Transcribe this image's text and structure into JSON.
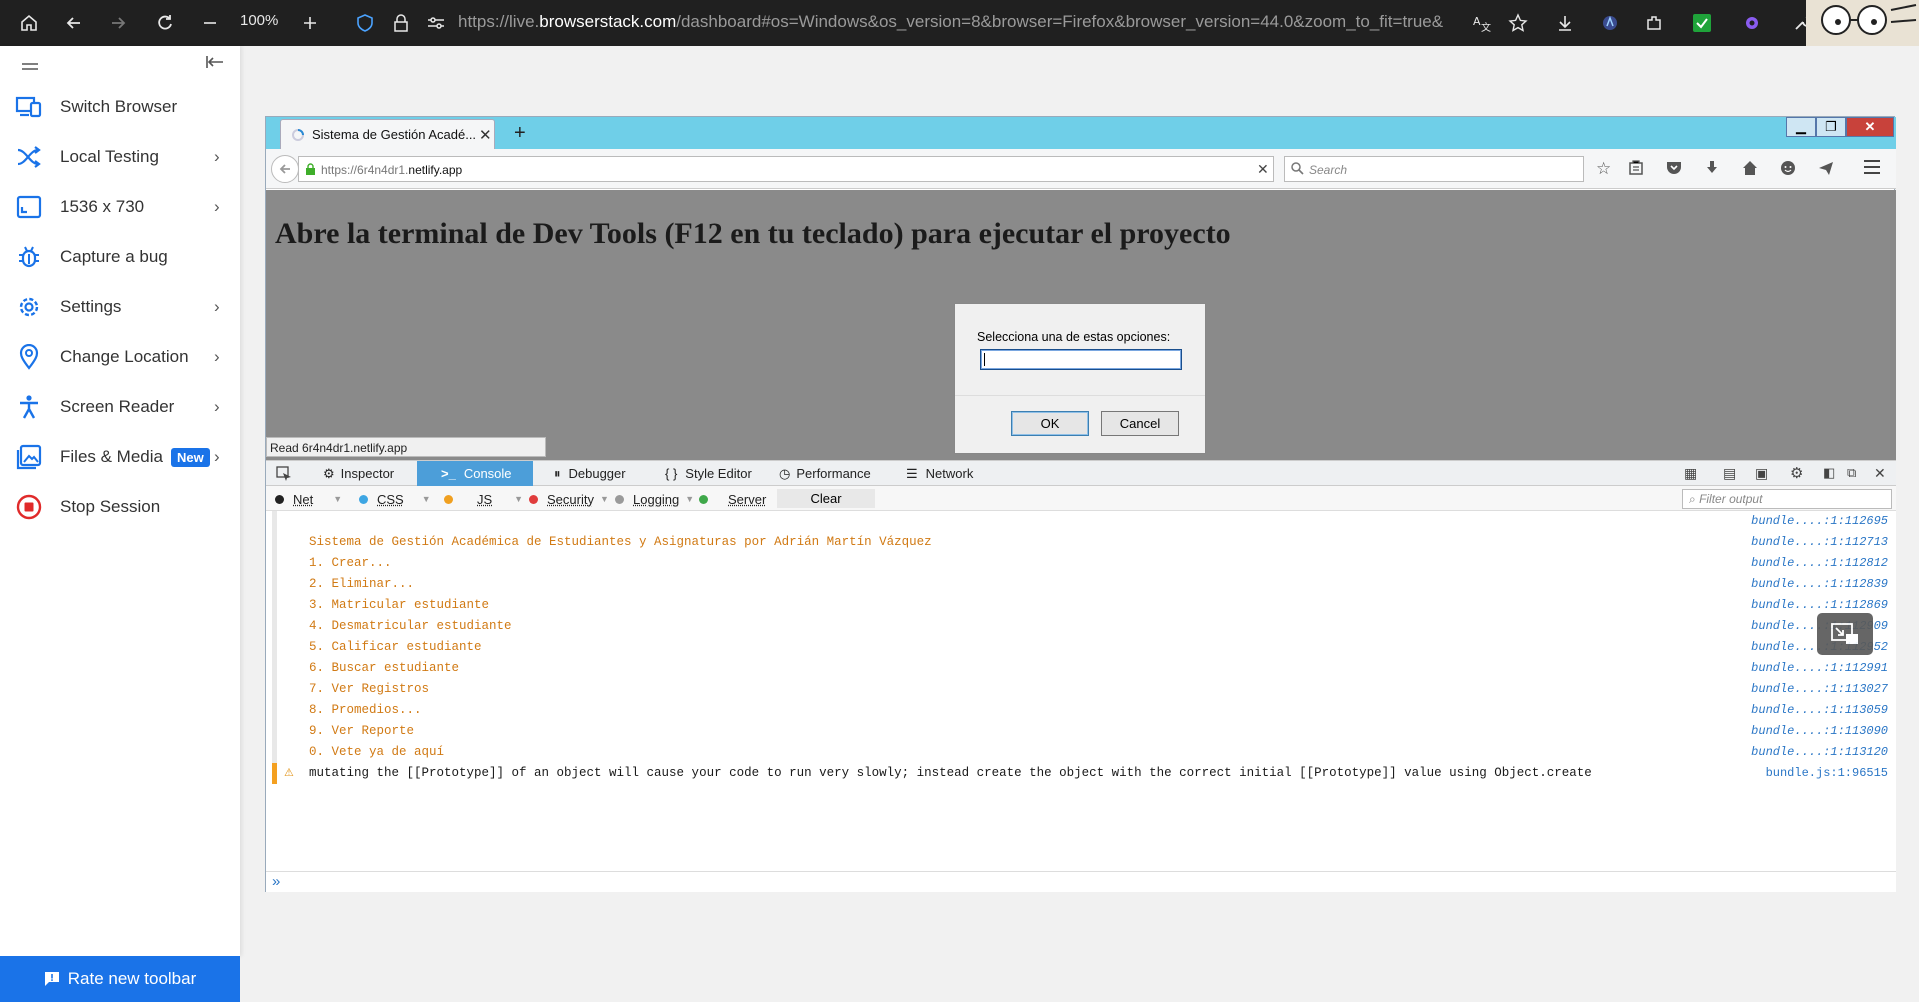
{
  "outer_browser": {
    "zoom": "100%",
    "url_prefix": "https://live.",
    "url_domain": "browserstack.com",
    "url_rest": "/dashboard#os=Windows&os_version=8&browser=Firefox&browser_version=44.0&zoom_to_fit=true&"
  },
  "sidebar": {
    "items": [
      {
        "label": "Switch Browser",
        "icon": "switch-browser-icon",
        "chevron": false
      },
      {
        "label": "Local Testing",
        "icon": "local-testing-icon",
        "chevron": true
      },
      {
        "label": "1536 x 730",
        "icon": "resolution-icon",
        "chevron": true
      },
      {
        "label": "Capture a bug",
        "icon": "bug-icon",
        "chevron": false
      },
      {
        "label": "Settings",
        "icon": "gear-icon",
        "chevron": true
      },
      {
        "label": "Change Location",
        "icon": "location-pin-icon",
        "chevron": true
      },
      {
        "label": "Screen Reader",
        "icon": "accessibility-icon",
        "chevron": true
      },
      {
        "label": "Files & Media",
        "icon": "image-icon",
        "chevron": true,
        "badge": "New"
      },
      {
        "label": "Stop Session",
        "icon": "stop-icon",
        "chevron": false
      }
    ],
    "rate_toolbar": "Rate new toolbar"
  },
  "remote": {
    "tab_title": "Sistema de Gestión Acadé...",
    "url_prefix": "https://6r4n4dr1.",
    "url_domain": "netlify.app",
    "search_placeholder": "Search",
    "page_heading": "Abre la terminal de Dev Tools (F12 en tu teclado) para ejecutar el proyecto",
    "status_text": "Read 6r4n4dr1.netlify.app",
    "dialog": {
      "message": "Selecciona una de estas opciones:",
      "input_value": "",
      "ok": "OK",
      "cancel": "Cancel"
    }
  },
  "devtools": {
    "tabs": [
      "Inspector",
      "Console",
      "Debugger",
      "Style Editor",
      "Performance",
      "Network"
    ],
    "active_tab": "Console",
    "filters": [
      {
        "label": "Net",
        "color": "#222222"
      },
      {
        "label": "CSS",
        "color": "#3ea6e3"
      },
      {
        "label": "JS",
        "color": "#f0a020"
      },
      {
        "label": "Security",
        "color": "#e03c3c"
      },
      {
        "label": "Logging",
        "color": "#9a9a9a"
      },
      {
        "label": "Server",
        "color": "#3fa84a"
      }
    ],
    "clear": "Clear",
    "filter_placeholder": "Filter output",
    "console_lines": [
      {
        "text": "",
        "loc": "bundle....:1:112695"
      },
      {
        "text": "Sistema de Gestión Académica de Estudiantes y Asignaturas por Adrián Martín Vázquez",
        "loc": "bundle....:1:112713"
      },
      {
        "text": "1. Crear...",
        "loc": "bundle....:1:112812"
      },
      {
        "text": "2. Eliminar...",
        "loc": "bundle....:1:112839"
      },
      {
        "text": "3. Matricular estudiante",
        "loc": "bundle....:1:112869"
      },
      {
        "text": "4. Desmatricular estudiante",
        "loc": "bundle....:1:112909"
      },
      {
        "text": "5. Calificar estudiante",
        "loc": "bundle....:1:112952"
      },
      {
        "text": "6. Buscar estudiante",
        "loc": "bundle....:1:112991"
      },
      {
        "text": "7. Ver Registros",
        "loc": "bundle....:1:113027"
      },
      {
        "text": "8. Promedios...",
        "loc": "bundle....:1:113059"
      },
      {
        "text": "9. Ver Reporte",
        "loc": "bundle....:1:113090"
      },
      {
        "text": "0. Vete ya de aquí",
        "loc": "bundle....:1:113120"
      }
    ],
    "warning": {
      "text": "mutating the [[Prototype]] of an object will cause your code to run very slowly; instead create the object with the correct initial [[Prototype]] value using Object.create",
      "loc": "bundle.js:1:96515"
    },
    "prompt": "»"
  }
}
